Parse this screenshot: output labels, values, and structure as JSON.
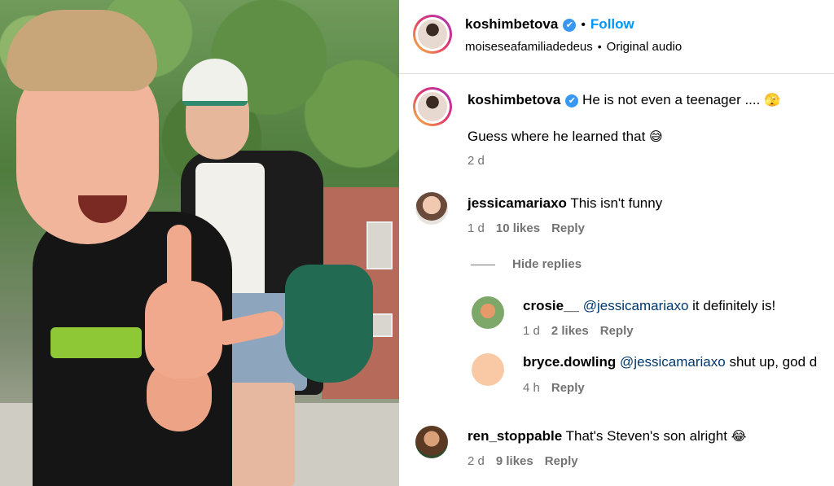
{
  "header": {
    "username": "koshimbetova",
    "verified_icon": "✔",
    "follow_label": "Follow",
    "separator": "•",
    "audio_user": "moiseseafamiliadedeus",
    "audio_label": "Original audio"
  },
  "caption": {
    "username": "koshimbetova",
    "verified_icon": "✔",
    "text_line1": "He is not even a teenager ....",
    "emoji1": "🫣",
    "text_line2": "Guess where he learned that",
    "emoji2": "😅",
    "time": "2 d"
  },
  "comments": [
    {
      "username": "jessicamariaxo",
      "text": "This isn't funny",
      "time": "1 d",
      "likes": "10 likes",
      "reply_label": "Reply",
      "hide_replies_label": "Hide replies",
      "replies": [
        {
          "username": "crosie__",
          "mention": "@jessicamariaxo",
          "text": "it definitely is!",
          "time": "1 d",
          "likes": "2 likes",
          "reply_label": "Reply"
        },
        {
          "username": "bryce.dowling",
          "mention": "@jessicamariaxo",
          "text": "shut up, god d",
          "time": "4 h",
          "reply_label": "Reply"
        }
      ]
    },
    {
      "username": "ren_stoppable",
      "text": "That's Steven's son alright",
      "emoji": "😂",
      "time": "2 d",
      "likes": "9 likes",
      "reply_label": "Reply"
    }
  ],
  "colors": {
    "follow": "#0095f6",
    "meta": "#737373",
    "verified": "#3897f0",
    "mention": "#00376b"
  }
}
